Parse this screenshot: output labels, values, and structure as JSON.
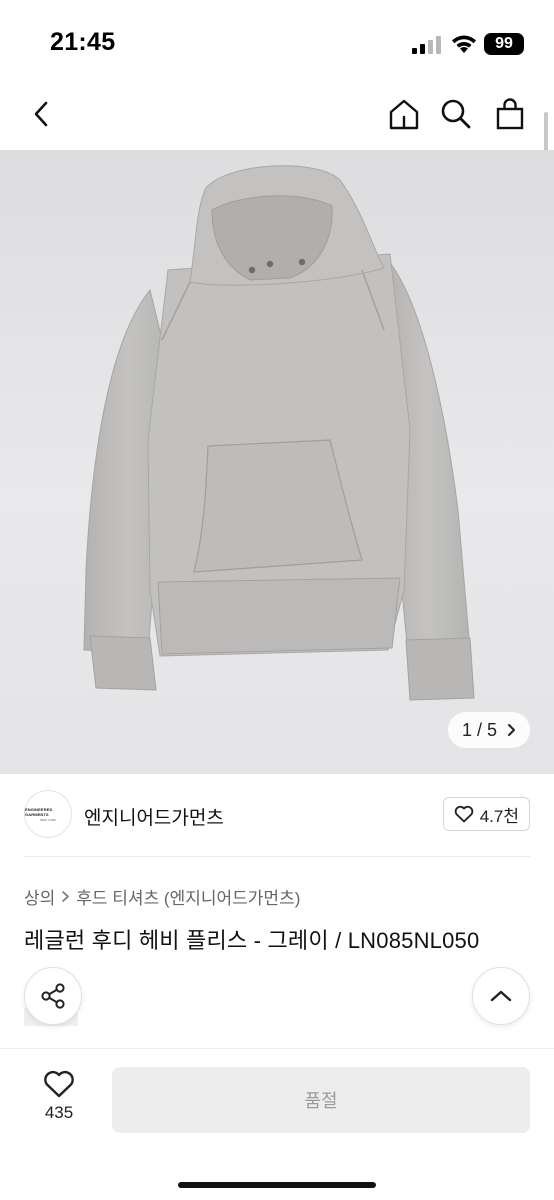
{
  "status_bar": {
    "time": "21:45",
    "battery": "99"
  },
  "nav": {
    "back_icon": "chevron-left-icon",
    "home_icon": "home-icon",
    "search_icon": "search-icon",
    "cart_icon": "shopping-bag-icon"
  },
  "gallery": {
    "counter": "1 / 5",
    "counter_icon": "chevron-right-icon"
  },
  "brand": {
    "name": "엔지니어드가먼츠",
    "logo_text": "ENGINEERED GARMENTS",
    "logo_sub": "NEW YORK",
    "likes": "4.7천"
  },
  "breadcrumb": {
    "category": "상의",
    "subcategory": "후드 티셔츠 (엔지니어드가먼츠)"
  },
  "product": {
    "title": "레글런 후디 헤비 플리스 - 그레이 / LN085NL050"
  },
  "bottom": {
    "wish_count": "435",
    "buy_label": "품절"
  },
  "colors": {
    "accent": "#111111",
    "soldout_bg": "#ededed",
    "image_bg": "#e6e6e8",
    "garment": "#bdbcbb"
  }
}
